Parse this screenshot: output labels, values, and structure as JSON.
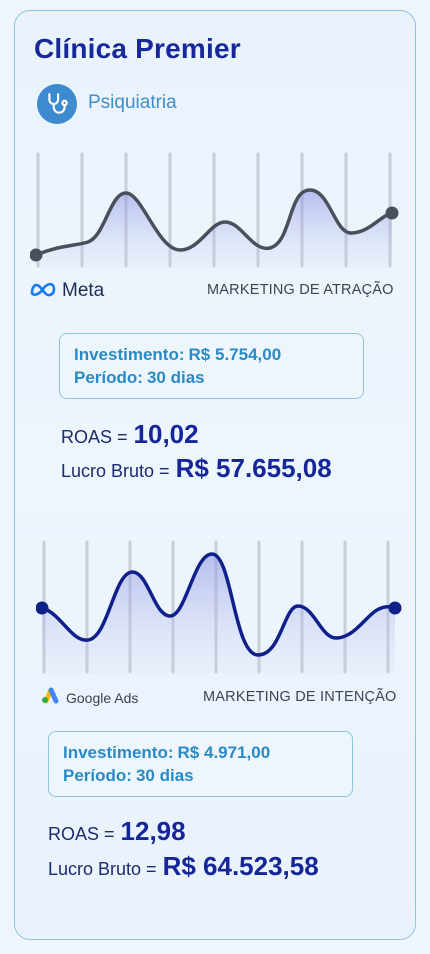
{
  "header": {
    "title": "Clínica Premier",
    "specialty": "Psiquiatria",
    "specialty_icon": "stethoscope-icon"
  },
  "sections": [
    {
      "platform": "Meta",
      "platform_icon": "meta-logo-icon",
      "marketing_label": "MARKETING DE ATRAÇÃO",
      "investment_label": "Investimento:",
      "investment_value": "R$ 5.754,00",
      "period_label": "Período:",
      "period_value": "30 dias",
      "roas_label": "ROAS =",
      "roas_value": "10,02",
      "profit_label": "Lucro Bruto =",
      "profit_value": "R$ 57.655,08",
      "line_color": "#4a4f5c"
    },
    {
      "platform": "Google Ads",
      "platform_icon": "google-ads-logo-icon",
      "marketing_label": "MARKETING DE INTENÇÃO",
      "investment_label": "Investimento:",
      "investment_value": "R$ 4.971,00",
      "period_label": "Período:",
      "period_value": "30 dias",
      "roas_label": "ROAS =",
      "roas_value": "12,98",
      "profit_label": "Lucro Bruto =",
      "profit_value": "R$ 64.523,58",
      "line_color": "#10208a"
    }
  ]
}
